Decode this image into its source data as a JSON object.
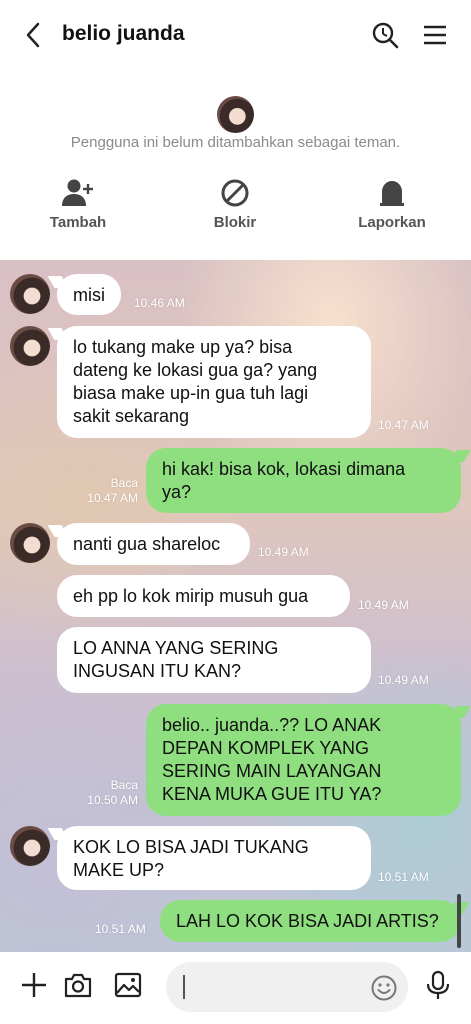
{
  "header": {
    "title": "belio juanda"
  },
  "profile": {
    "notice": "Pengguna ini belum ditambahkan sebagai teman.",
    "actions": {
      "add": "Tambah",
      "block": "Blokir",
      "report": "Laporkan"
    }
  },
  "messages": [
    {
      "text": "misi",
      "time": "10.46 AM"
    },
    {
      "text": "lo tukang make up ya? bisa\ndateng ke lokasi gua ga? yang\nbiasa make up-in gua tuh lagi\nsakit sekarang",
      "time": "10.47 AM"
    },
    {
      "text": "hi kak! bisa kok, lokasi dimana\nya?",
      "time": "10.47 AM",
      "read": "Baca"
    },
    {
      "text": "nanti gua shareloc",
      "time": "10.49 AM"
    },
    {
      "text": "eh  pp lo kok mirip musuh gua",
      "time": "10.49 AM"
    },
    {
      "text": "LO ANNA YANG SERING\nINGUSAN ITU KAN?",
      "time": "10.49 AM"
    },
    {
      "text": "belio.. juanda..?? LO ANAK\nDEPAN KOMPLEK YANG\nSERING MAIN LAYANGAN\nKENA MUKA GUE ITU YA?",
      "time": "10.50 AM",
      "read": "Baca"
    },
    {
      "text": "KOK LO BISA JADI TUKANG\nMAKE UP?",
      "time": "10.51 AM"
    },
    {
      "text": "LAH LO KOK BISA JADI ARTIS?",
      "time": "10.51 AM"
    }
  ],
  "colors": {
    "outgoing": "#8fdf80",
    "incoming": "#ffffff"
  },
  "icons": [
    "back-arrow-icon",
    "search-icon",
    "menu-icon",
    "add-friend-icon",
    "block-icon",
    "report-icon",
    "plus-icon",
    "camera-icon",
    "gallery-icon",
    "emoji-icon",
    "microphone-icon"
  ]
}
